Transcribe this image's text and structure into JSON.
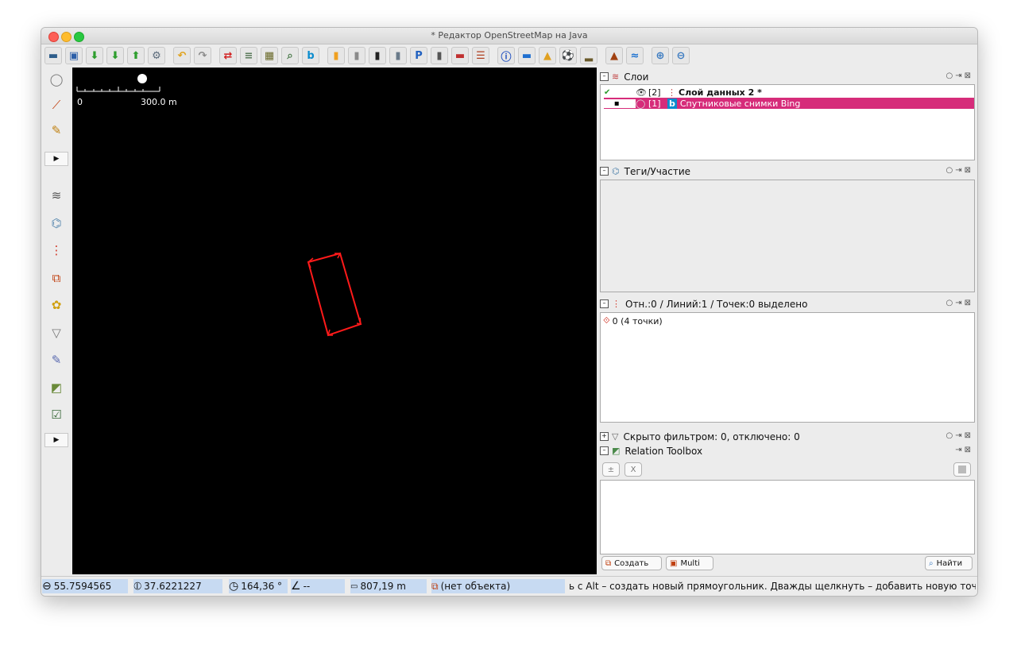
{
  "window": {
    "title": "* Редактор OpenStreetMap на Java"
  },
  "toolbar": {
    "buttons": [
      {
        "name": "open-file",
        "glyph": "▬",
        "color": "#2d5d8a"
      },
      {
        "name": "save",
        "glyph": "▣",
        "color": "#2b5ea8"
      },
      {
        "name": "download",
        "glyph": "⬇",
        "color": "#2e9e2e"
      },
      {
        "name": "download-along",
        "glyph": "⬇",
        "color": "#2e9e2e"
      },
      {
        "name": "upload",
        "glyph": "⬆",
        "color": "#2e9e2e"
      },
      {
        "name": "preferences",
        "glyph": "⚙",
        "color": "#5a6a7a"
      },
      {
        "name": "undo",
        "glyph": "↶",
        "color": "#e0a21c"
      },
      {
        "name": "redo",
        "glyph": "↷",
        "color": "#8a8a8a"
      },
      {
        "name": "reverse-way",
        "glyph": "⇄",
        "color": "#d22020"
      },
      {
        "name": "align-in-line",
        "glyph": "≡",
        "color": "#5a7a5a"
      },
      {
        "name": "grid",
        "glyph": "▦",
        "color": "#6a6a2a"
      },
      {
        "name": "search",
        "glyph": "⌕",
        "color": "#4a7a4a"
      },
      {
        "name": "bing",
        "glyph": "b",
        "color": "#0b8cce"
      },
      {
        "name": "road-yellow",
        "glyph": "▮",
        "color": "#f0a020"
      },
      {
        "name": "road-gray",
        "glyph": "▮",
        "color": "#8a8a8a"
      },
      {
        "name": "road-black",
        "glyph": "▮",
        "color": "#222222"
      },
      {
        "name": "road-secondary",
        "glyph": "▮",
        "color": "#6a7a8a"
      },
      {
        "name": "parking",
        "glyph": "P",
        "color": "#2060c0"
      },
      {
        "name": "traffic-signal",
        "glyph": "▮",
        "color": "#555555"
      },
      {
        "name": "wall",
        "glyph": "▬",
        "color": "#c03030"
      },
      {
        "name": "railway",
        "glyph": "☰",
        "color": "#b04020"
      },
      {
        "name": "information",
        "glyph": "ⓘ",
        "color": "#2050c0"
      },
      {
        "name": "hotel",
        "glyph": "▬",
        "color": "#2070d0"
      },
      {
        "name": "shop",
        "glyph": "▲",
        "color": "#e0a020"
      },
      {
        "name": "sports",
        "glyph": "⚽",
        "color": "#222222"
      },
      {
        "name": "industrial",
        "glyph": "▂",
        "color": "#6a5a2a"
      },
      {
        "name": "mountain",
        "glyph": "▲",
        "color": "#a04010"
      },
      {
        "name": "waterway",
        "glyph": "≈",
        "color": "#1a70d0"
      },
      {
        "name": "zoom-in",
        "glyph": "⊕",
        "color": "#3a7ac0"
      },
      {
        "name": "zoom-out",
        "glyph": "⊖",
        "color": "#3a7ac0"
      }
    ]
  },
  "leftbar": {
    "top_tools": [
      {
        "name": "lasso-icon",
        "glyph": "◯",
        "color": "#777777"
      },
      {
        "name": "draw-way-icon",
        "glyph": "⟋",
        "color": "#c04010"
      },
      {
        "name": "pencil-icon",
        "glyph": "✎",
        "color": "#c08010"
      }
    ],
    "more_label": "▶",
    "dialog_toggles": [
      {
        "name": "layers-toggle-icon",
        "glyph": "≋",
        "color": "#555555"
      },
      {
        "name": "tags-toggle-icon",
        "glyph": "⌬",
        "color": "#5a8ab0"
      },
      {
        "name": "selection-toggle-icon",
        "glyph": "⋮",
        "color": "#d03020"
      },
      {
        "name": "relations-toggle-icon",
        "glyph": "⧉",
        "color": "#c04010"
      },
      {
        "name": "conflict-toggle-icon",
        "glyph": "✿",
        "color": "#d0a010"
      },
      {
        "name": "filter-toggle-icon",
        "glyph": "▽",
        "color": "#777777"
      },
      {
        "name": "map-paint-icon",
        "glyph": "✎",
        "color": "#5a6ab0"
      },
      {
        "name": "changeset-icon",
        "glyph": "◩",
        "color": "#6a8a3a"
      },
      {
        "name": "validator-icon",
        "glyph": "☑",
        "color": "#3a6a3a"
      }
    ],
    "more_label_2": "▶"
  },
  "map": {
    "scale_zero": "0",
    "scale_label": "300.0 m"
  },
  "layers_panel": {
    "title": "Слои",
    "rows": [
      {
        "index": "[2]",
        "name": "Слой данных 2 *",
        "active": true,
        "visible": true
      },
      {
        "index": "[1]",
        "name": "Спутниковые снимки Bing",
        "active": false,
        "visible": false
      }
    ]
  },
  "tags_panel": {
    "title": "Теги/Участие"
  },
  "selection_panel": {
    "title": "Отн.:0 / Линий:1 / Точек:0 выделено",
    "items": [
      "0 (4 точки)"
    ]
  },
  "filter_panel": {
    "title": "Скрыто фильтром: 0, отключено: 0"
  },
  "relation_toolbox": {
    "title": "Relation Toolbox",
    "add_label": "±",
    "remove_label": "X",
    "create_label": "Создать",
    "multi_label": "Multi",
    "find_label": "Найти"
  },
  "statusbar": {
    "lat": "55.7594565",
    "lon": "37.6221227",
    "heading": "164,36 °",
    "angle": "--",
    "distance": "807,19 m",
    "object": "(нет объекта)",
    "help": "ь с Alt – создать новый прямоугольник. Дважды щелкнуть – добавить новую точку."
  }
}
